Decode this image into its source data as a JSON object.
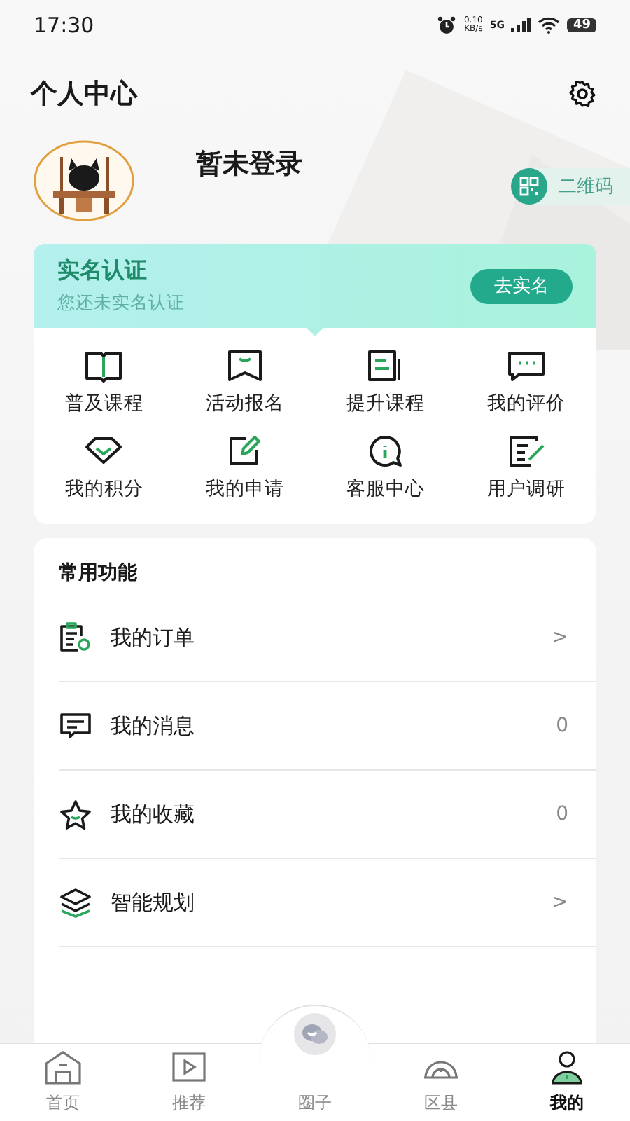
{
  "status_bar": {
    "time": "17:30",
    "net_speed": "0.10",
    "net_unit": "KB/s",
    "network": "5G",
    "battery": "49"
  },
  "header": {
    "title": "个人中心"
  },
  "profile": {
    "name": "暂未登录",
    "qr_button": "二维码"
  },
  "verify": {
    "title": "实名认证",
    "subtitle": "您还未实名认证",
    "button": "去实名"
  },
  "grid": [
    {
      "kind": "book",
      "label": "普及课程"
    },
    {
      "kind": "bookmark",
      "label": "活动报名"
    },
    {
      "kind": "doc",
      "label": "提升课程"
    },
    {
      "kind": "chat",
      "label": "我的评价"
    },
    {
      "kind": "gem",
      "label": "我的积分"
    },
    {
      "kind": "edit",
      "label": "我的申请"
    },
    {
      "kind": "info",
      "label": "客服中心"
    },
    {
      "kind": "survey",
      "label": "用户调研"
    }
  ],
  "common": {
    "title": "常用功能",
    "items": [
      {
        "kind": "order",
        "label": "我的订单",
        "value": ">"
      },
      {
        "kind": "message",
        "label": "我的消息",
        "value": "0"
      },
      {
        "kind": "star",
        "label": "我的收藏",
        "value": "0"
      },
      {
        "kind": "layers",
        "label": "智能规划",
        "value": ">"
      }
    ]
  },
  "nav": [
    {
      "kind": "home",
      "label": "首页",
      "selected": false
    },
    {
      "kind": "play",
      "label": "推荐",
      "selected": false
    },
    {
      "kind": "circle",
      "label": "圈子",
      "selected": false
    },
    {
      "kind": "county",
      "label": "区县",
      "selected": false
    },
    {
      "kind": "user",
      "label": "我的",
      "selected": true
    }
  ]
}
